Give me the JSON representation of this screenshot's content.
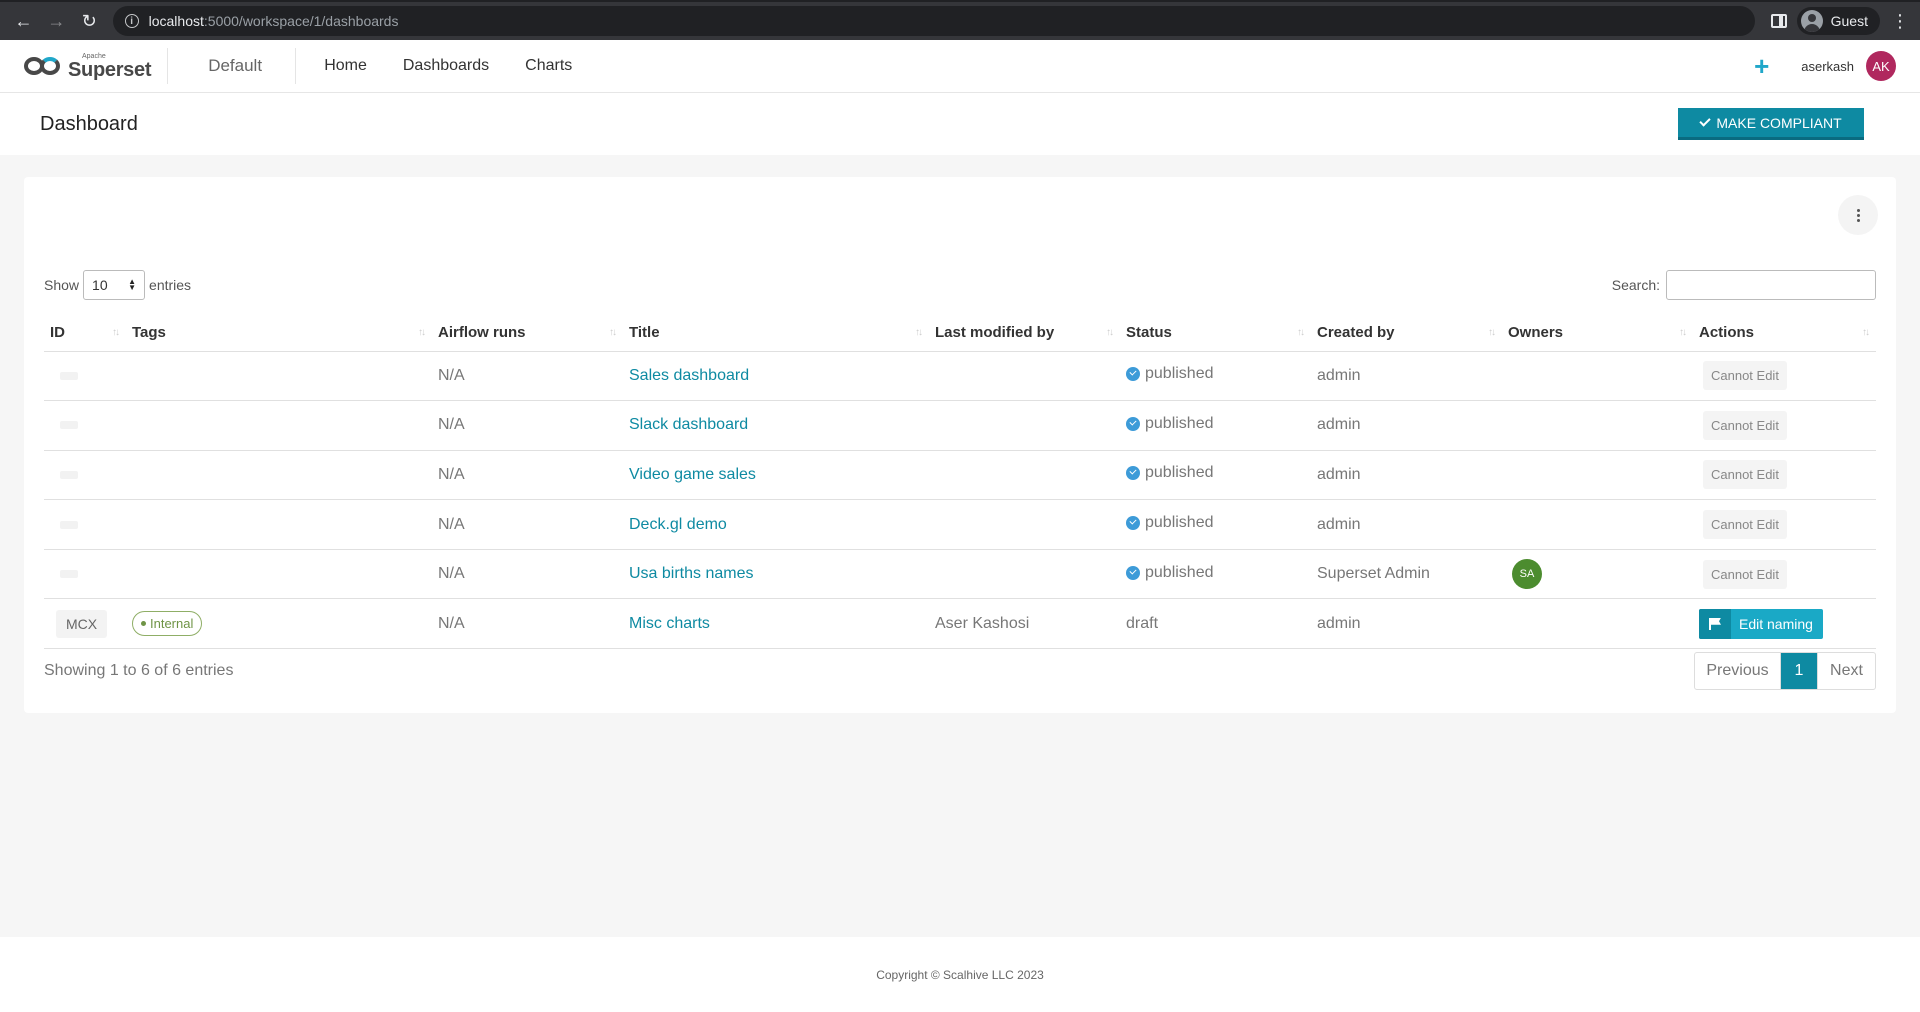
{
  "browser": {
    "url_host": "localhost",
    "url_rest": ":5000/workspace/1/dashboards",
    "profile": "Guest"
  },
  "app": {
    "brand_small": "Apache",
    "brand": "Superset",
    "workspace": "Default",
    "menu": [
      "Home",
      "Dashboards",
      "Charts"
    ],
    "username": "aserkash",
    "avatar_initials": "AK"
  },
  "page": {
    "title": "Dashboard",
    "compliant_button": "MAKE COMPLIANT"
  },
  "table": {
    "show_label": "Show",
    "entries_label": "entries",
    "page_size": "10",
    "search_label": "Search:",
    "columns": [
      "ID",
      "Tags",
      "Airflow runs",
      "Title",
      "Last modified by",
      "Status",
      "Created by",
      "Owners",
      "Actions"
    ],
    "rows": [
      {
        "id": "",
        "tag": "",
        "airflow": "N/A",
        "title": "Sales dashboard",
        "modified_by": "",
        "status": "published",
        "created_by": "admin",
        "owner": "",
        "action": "Cannot Edit"
      },
      {
        "id": "",
        "tag": "",
        "airflow": "N/A",
        "title": "Slack dashboard",
        "modified_by": "",
        "status": "published",
        "created_by": "admin",
        "owner": "",
        "action": "Cannot Edit"
      },
      {
        "id": "",
        "tag": "",
        "airflow": "N/A",
        "title": "Video game sales",
        "modified_by": "",
        "status": "published",
        "created_by": "admin",
        "owner": "",
        "action": "Cannot Edit"
      },
      {
        "id": "",
        "tag": "",
        "airflow": "N/A",
        "title": "Deck.gl demo",
        "modified_by": "",
        "status": "published",
        "created_by": "admin",
        "owner": "",
        "action": "Cannot Edit"
      },
      {
        "id": "",
        "tag": "",
        "airflow": "N/A",
        "title": "Usa births names",
        "modified_by": "",
        "status": "published",
        "created_by": "Superset Admin",
        "owner": "SA",
        "action": "Cannot Edit"
      },
      {
        "id": "MCX",
        "tag": "Internal",
        "airflow": "N/A",
        "title": "Misc charts",
        "modified_by": "Aser Kashosi",
        "status": "draft",
        "created_by": "admin",
        "owner": "",
        "action": "Edit naming"
      }
    ],
    "showing": "Showing 1 to 6 of 6 entries",
    "pager": {
      "prev": "Previous",
      "current": "1",
      "next": "Next"
    }
  },
  "footer": {
    "copyright": "Copyright © Scalhive LLC 2023"
  },
  "colors": {
    "accent": "#0e8aa2",
    "avatar": "#b0285e",
    "owner_avatar": "#4c8c2f"
  }
}
